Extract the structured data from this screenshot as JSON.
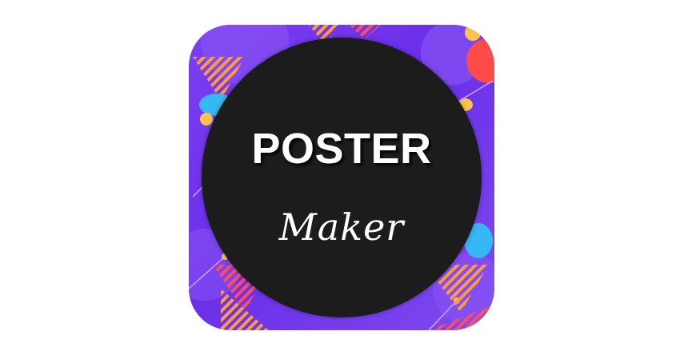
{
  "app_icon": {
    "title": "POSTER",
    "subtitle": "Maker",
    "colors": {
      "background": "#7b3ff2",
      "badge": "#1c1c1c",
      "accent_orange": "#ff8a3d",
      "accent_red": "#ff4a4a",
      "accent_blue": "#36b8f5",
      "accent_yellow": "#ffc24a"
    }
  }
}
